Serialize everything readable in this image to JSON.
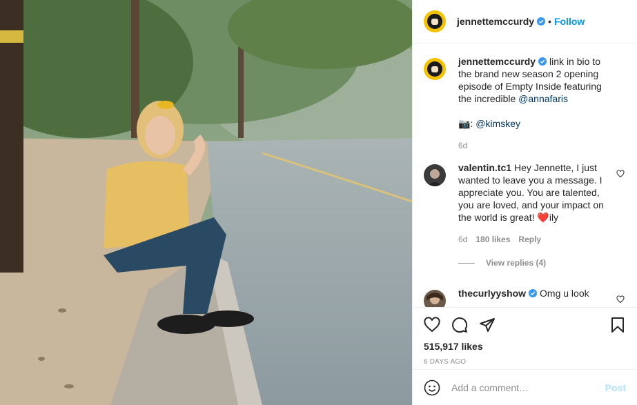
{
  "header": {
    "username": "jennettemccurdy",
    "follow_label": "Follow",
    "separator": "•"
  },
  "caption": {
    "username": "jennettemccurdy",
    "text_1": "link in bio to the brand new season 2 opening episode of Empty Inside featuring the incredible",
    "mention_1": "@annafaris",
    "camera_emoji": "📷",
    "credit_sep": ":",
    "mention_2": "@kimskey",
    "age": "6d"
  },
  "comments": [
    {
      "username": "valentin.tc1",
      "text": "Hey Jennette, I just wanted to leave you a message. I appreciate you. You are talented, you are loved, and your impact on the world is great!",
      "emoji": "❤️",
      "suffix": "ily",
      "age": "6d",
      "likes": "180 likes",
      "reply_label": "Reply",
      "view_replies": "View replies (4)"
    },
    {
      "username": "thecurlyyshow",
      "text": "Omg u look"
    }
  ],
  "actions": {
    "likes": "515,917 likes",
    "age": "6 DAYS AGO"
  },
  "add_comment": {
    "placeholder": "Add a comment…",
    "post_label": "Post"
  },
  "colors": {
    "link": "#0095f6",
    "mention": "#00376b",
    "muted": "#8e8e8e",
    "verified": "#3897f0",
    "avatar_bg": "#f4c300"
  },
  "icons": [
    "heart-icon",
    "comment-icon",
    "share-icon",
    "bookmark-icon",
    "smile-icon",
    "verified-icon"
  ]
}
